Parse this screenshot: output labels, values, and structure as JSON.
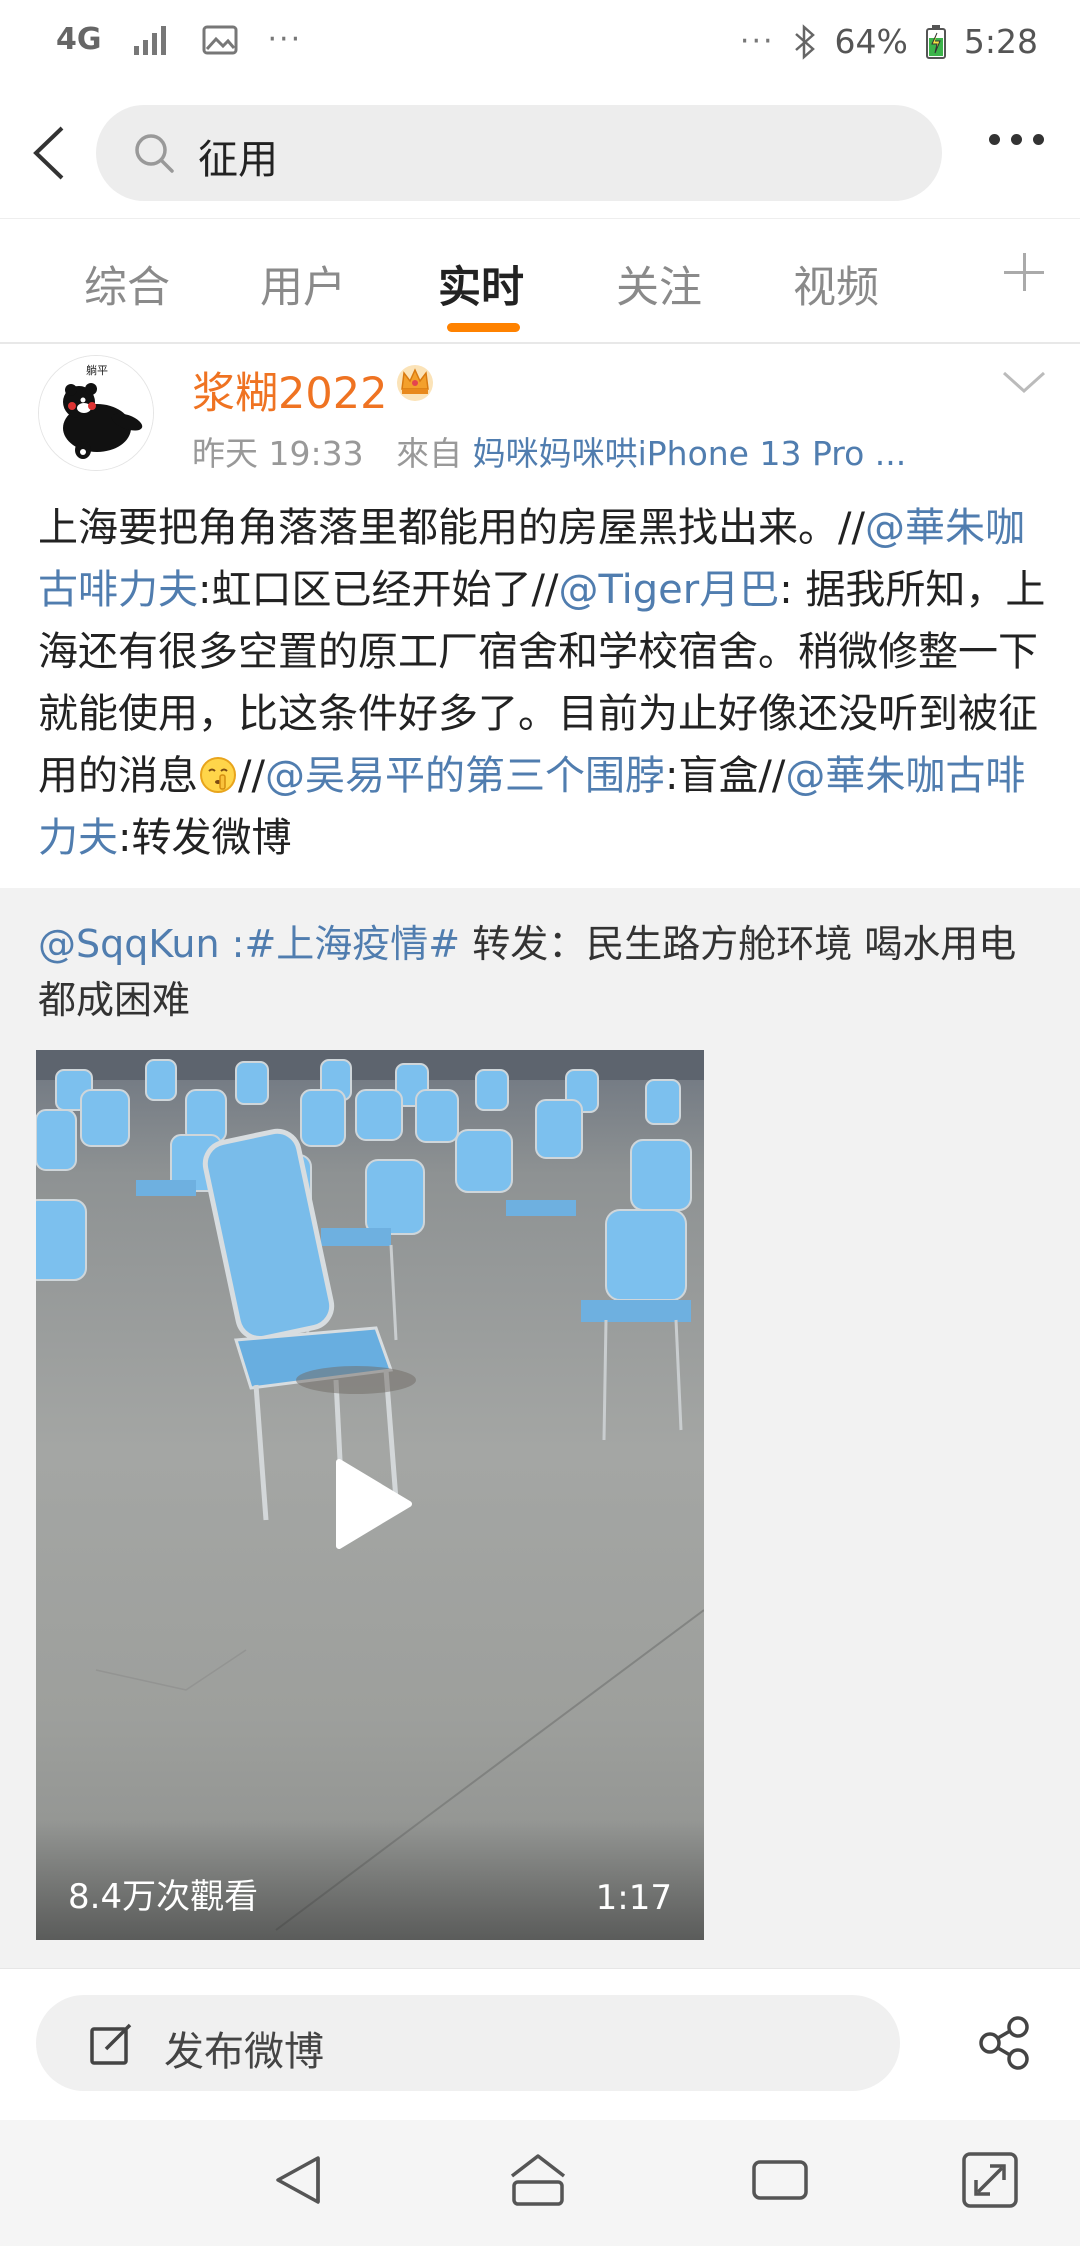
{
  "status_bar": {
    "network": "4G",
    "dots_left": "···",
    "dots_right": "···",
    "battery": "64%",
    "time": "5:28"
  },
  "search": {
    "query": "征用"
  },
  "tabs": [
    {
      "label": "综合"
    },
    {
      "label": "用户"
    },
    {
      "label": "实时"
    },
    {
      "label": "关注"
    },
    {
      "label": "视频"
    }
  ],
  "post": {
    "username": "浆糊2022",
    "time": "昨天 19:33",
    "from_label": "來自",
    "source": "妈咪妈咪哄iPhone 13 Pro ...",
    "text": {
      "p1": "上海要把角角落落里都能用的房屋黑找出来。//",
      "m1": "@華朱咖古啡力夫",
      "p2": ":虹口区已经开始了//",
      "m2": "@Tiger月巴",
      "p3": ": 据我所知，上海还有很多空置的原工厂宿舍和学校宿舍。稍微修整一下就能使用，比这条件好多了。目前为止好像还没听到被征用的消息",
      "p4": "//",
      "m3": "@吴易平的第三个围脖",
      "p5": ":盲盒//",
      "m4": "@華朱咖古啡力夫",
      "p6": ":转发微博"
    }
  },
  "retweet": {
    "user": "@SqqKun",
    "sep": " :",
    "hashtag": "#上海疫情#",
    "text": "  转发：民生路方舱环境 喝水用电都成困难",
    "video": {
      "views": "8.4万次觀看",
      "duration": "1:17"
    }
  },
  "compose": {
    "placeholder": "发布微博"
  },
  "colors": {
    "accent": "#ff8200",
    "link": "#507daf",
    "username": "#ef7322",
    "chair_blue": "#6fb4e6"
  }
}
